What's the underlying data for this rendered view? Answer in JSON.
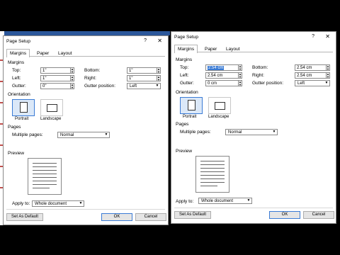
{
  "dialogs": [
    {
      "title": "Page Setup",
      "help": "?",
      "close": "✕",
      "tabs": [
        "Margins",
        "Paper",
        "Layout"
      ],
      "margins_heading": "Margins",
      "top_label": "Top:",
      "top_value": "1\"",
      "bottom_label": "Bottom:",
      "bottom_value": "1\"",
      "left_label": "Left:",
      "left_value": "1\"",
      "right_label": "Right:",
      "right_value": "1\"",
      "gutter_label": "Gutter:",
      "gutter_value": "0\"",
      "gutter_position_label": "Gutter position:",
      "gutter_position_value": "Left",
      "orientation_heading": "Orientation",
      "portrait": "Portrait",
      "landscape": "Landscape",
      "pages_heading": "Pages",
      "multiple_pages_label": "Multiple pages:",
      "multiple_pages_value": "Normal",
      "preview_heading": "Preview",
      "apply_to_label": "Apply to:",
      "apply_to_value": "Whole document",
      "set_default": "Set As Default",
      "ok": "OK",
      "cancel": "Cancel"
    },
    {
      "title": "Page Setup",
      "help": "?",
      "close": "✕",
      "tabs": [
        "Margins",
        "Paper",
        "Layout"
      ],
      "margins_heading": "Margins",
      "top_label": "Top:",
      "top_value": "2.54 cm",
      "bottom_label": "Bottom:",
      "bottom_value": "2.54 cm",
      "left_label": "Left:",
      "left_value": "2.54 cm",
      "right_label": "Right:",
      "right_value": "2.54 cm",
      "gutter_label": "Gutter:",
      "gutter_value": "0 cm",
      "gutter_position_label": "Gutter position:",
      "gutter_position_value": "Left",
      "orientation_heading": "Orientation",
      "portrait": "Portrait",
      "landscape": "Landscape",
      "pages_heading": "Pages",
      "multiple_pages_label": "Multiple pages:",
      "multiple_pages_value": "Normal",
      "preview_heading": "Preview",
      "apply_to_label": "Apply to:",
      "apply_to_value": "Whole document",
      "set_default": "Set As Default",
      "ok": "OK",
      "cancel": "Cancel"
    }
  ],
  "colors": {
    "accent": "#3a7bd5",
    "word_blue": "#2b579a",
    "selected_fill": "#dbe8f8"
  },
  "icons": {
    "portrait": "portrait-page-icon",
    "landscape": "landscape-page-icon",
    "dropdown": "chevron-down-icon",
    "spin": "spin-arrows-icon"
  }
}
